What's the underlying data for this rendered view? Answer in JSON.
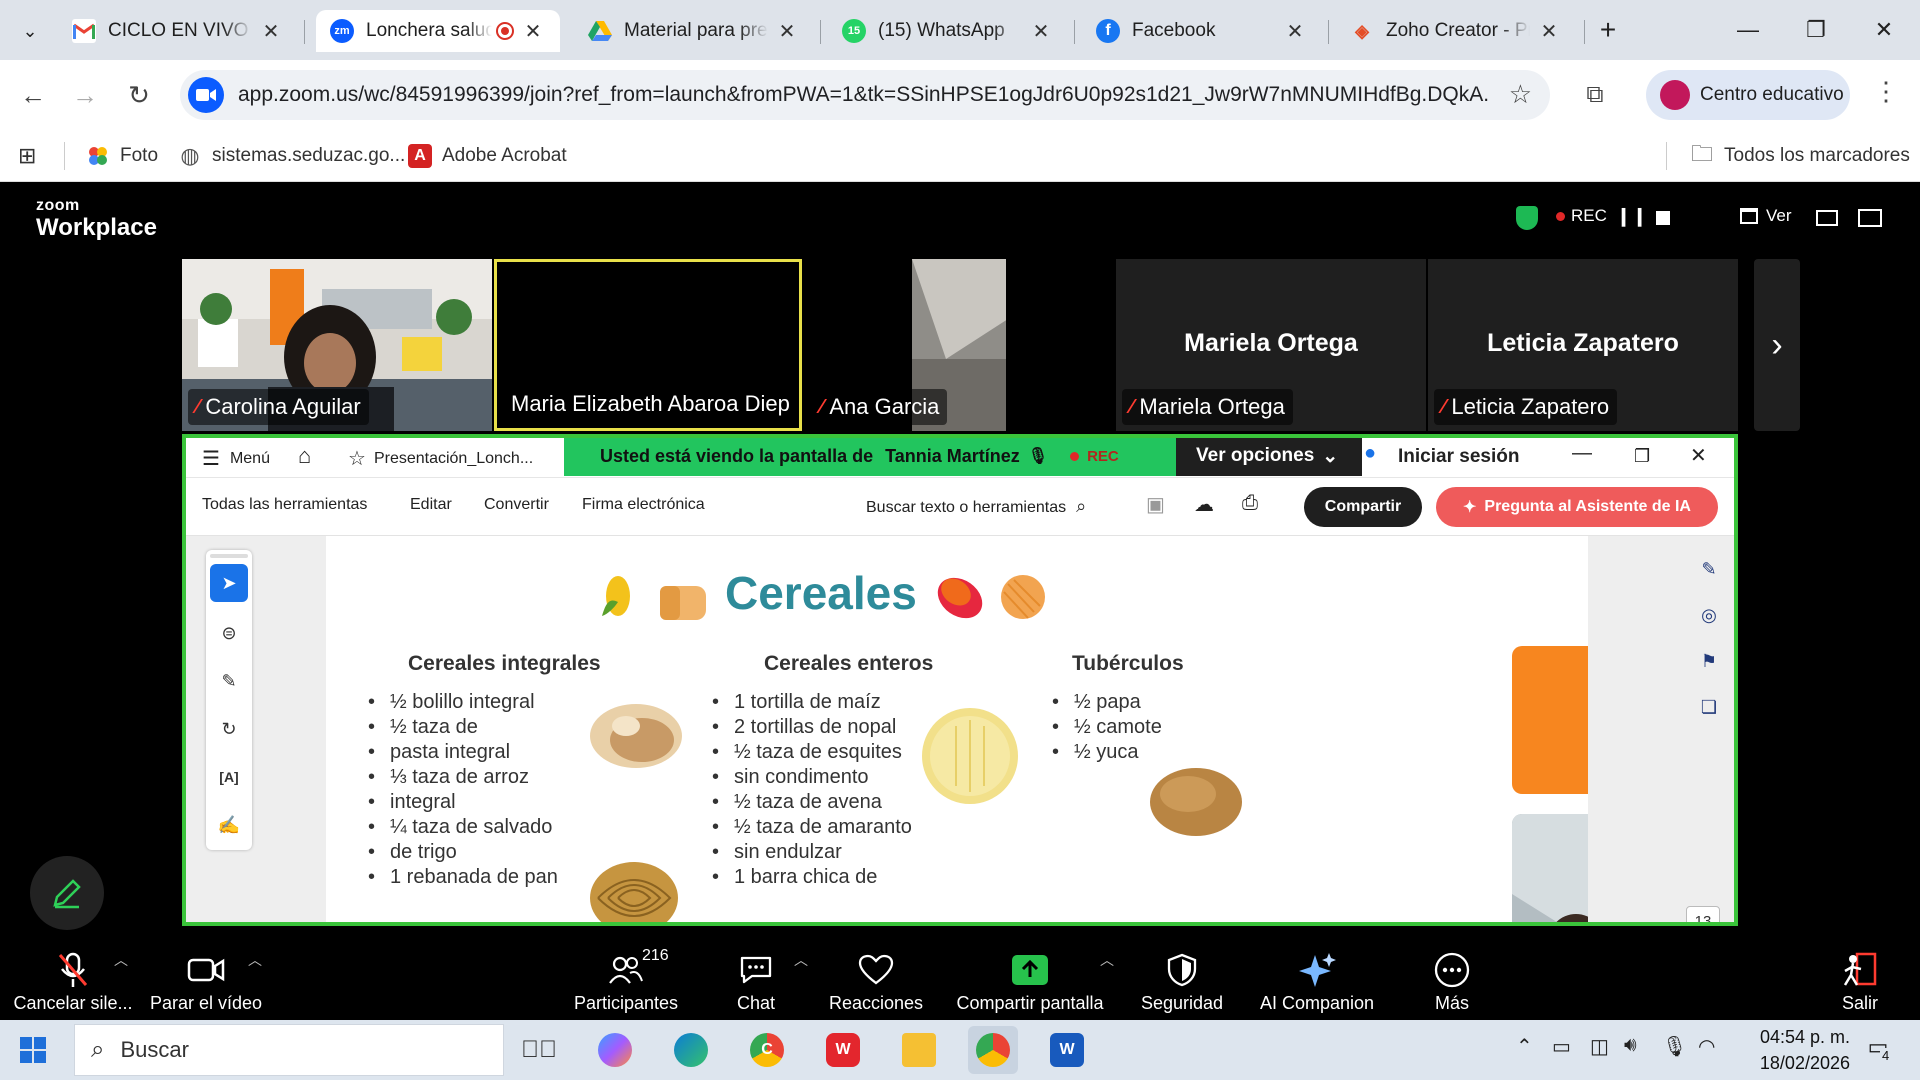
{
  "tabs": [
    {
      "title": "CICLO EN VIVO PARA",
      "icon": "gmail-icon",
      "color": "#ea4335"
    },
    {
      "title": "Lonchera saludable",
      "icon": "zoom-icon",
      "color": "#0b5cff",
      "active": true
    },
    {
      "title": "Material para presentación",
      "icon": "drive-icon",
      "color": "#1fa463"
    },
    {
      "title": "(15) WhatsApp",
      "icon": "whatsapp-icon",
      "color": "#25d366"
    },
    {
      "title": "Facebook",
      "icon": "facebook-icon",
      "color": "#1877f2"
    },
    {
      "title": "Zoho Creator - Pr",
      "icon": "zoho-icon",
      "color": "#e44d26"
    }
  ],
  "tab_labels": {
    "whatsapp_badge": "15",
    "zoom_fav": "zm"
  },
  "address": {
    "url": "app.zoom.us/wc/84591996399/join?ref_from=launch&fromPWA=1&tk=SSinHPSE1ogJdr6U0p92s1d21_Jw9rW7nMNUMIHdfBg.DQkA...",
    "profile": "Centro educativo"
  },
  "bookmarks": [
    {
      "label": "Foto",
      "icon": "google-photos-icon"
    },
    {
      "label": "sistemas.seduzac.go...",
      "icon": "globe-icon"
    },
    {
      "label": "Adobe Acrobat",
      "icon": "acrobat-icon"
    }
  ],
  "bookmarks_all": "Todos los marcadores",
  "zoom": {
    "logo_top": "zoom",
    "logo_bottom": "Workplace",
    "rec": "REC",
    "view": "Ver",
    "participants": [
      {
        "name": "Carolina Aguilar",
        "muted": true
      },
      {
        "name": "Maria Elizabeth Abaroa Diep",
        "muted": false
      },
      {
        "name": "Ana Garcia",
        "muted": true
      },
      {
        "name": "Mariela Ortega",
        "muted": true,
        "big": "Mariela Ortega"
      },
      {
        "name": "Leticia Zapatero",
        "muted": true,
        "big": "Leticia Zapatero"
      }
    ],
    "banner_prefix": "Usted está viendo la pantalla de",
    "banner_name": "Tannia Martínez",
    "banner_rec": "REC",
    "view_options": "Ver opciones"
  },
  "acrobat": {
    "menu": "Menú",
    "doc_tab": "Presentación_Lonch...",
    "signin": "Iniciar sesión",
    "tools": [
      "Todas las herramientas",
      "Editar",
      "Convertir",
      "Firma electrónica"
    ],
    "search": "Buscar texto o herramientas",
    "share": "Compartir",
    "ai": "Pregunta al Asistente de IA",
    "page_number": "13"
  },
  "slide": {
    "title": "Cereales",
    "columns": [
      {
        "heading": "Cereales integrales",
        "items": [
          "½ bolillo integral",
          "½ taza de",
          "pasta integral",
          "⅓ taza de arroz",
          "integral",
          "¼ taza de salvado",
          "de trigo",
          "1 rebanada de pan"
        ]
      },
      {
        "heading": "Cereales enteros",
        "items": [
          "1 tortilla de maíz",
          "2 tortillas de nopal",
          "½ taza de esquites",
          "sin condimento",
          "½ taza de avena",
          "½ taza de amaranto",
          "sin endulzar",
          "1 barra chica de"
        ]
      },
      {
        "heading": "Tubérculos",
        "items": [
          "½ papa",
          "½ camote",
          "½ yuca"
        ]
      }
    ]
  },
  "toolbar": [
    {
      "label": "Cancelar sile...",
      "icon": "microphone-muted-icon"
    },
    {
      "label": "Parar el vídeo",
      "icon": "video-camera-icon"
    },
    {
      "label": "Participantes",
      "icon": "participants-icon",
      "count": "216"
    },
    {
      "label": "Chat",
      "icon": "chat-icon"
    },
    {
      "label": "Reacciones",
      "icon": "heart-icon"
    },
    {
      "label": "Compartir pantalla",
      "icon": "share-screen-icon"
    },
    {
      "label": "Seguridad",
      "icon": "shield-icon"
    },
    {
      "label": "AI Companion",
      "icon": "sparkle-icon"
    },
    {
      "label": "Más",
      "icon": "more-icon"
    },
    {
      "label": "Salir",
      "icon": "leave-icon"
    }
  ],
  "taskbar": {
    "search": "Buscar",
    "time": "04:54 p. m.",
    "date": "18/02/2026",
    "notifications": "4",
    "apps": [
      {
        "name": "task-view",
        "label": ""
      },
      {
        "name": "copilot",
        "label": ""
      },
      {
        "name": "edge",
        "label": ""
      },
      {
        "name": "chrome",
        "label": "C"
      },
      {
        "name": "wps",
        "label": "W"
      },
      {
        "name": "file-explorer",
        "label": ""
      },
      {
        "name": "chrome-active",
        "label": ""
      },
      {
        "name": "word",
        "label": "W"
      }
    ]
  }
}
